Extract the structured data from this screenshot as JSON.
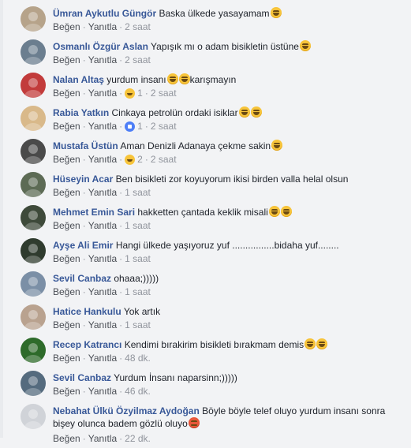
{
  "actions": {
    "like": "Beğen",
    "reply": "Yanıtla",
    "dot": "·"
  },
  "comments": [
    {
      "name": "Ümran Aykutlu Güngör",
      "text": "Baska ülkede yasayamam",
      "emoji": "laugh",
      "emoji_count": 1,
      "reaction": null,
      "time": "2 saat"
    },
    {
      "name": "Osmanlı Özgür Aslan",
      "text": "Yapışık mı o adam bisikletin üstüne",
      "emoji": "laugh",
      "emoji_count": 1,
      "reaction": null,
      "time": "2 saat"
    },
    {
      "name": "Nalan Altaş",
      "text": "yurdum insanı",
      "text_after": "karışmayın",
      "emoji": "laugh",
      "emoji_count": 2,
      "reaction": {
        "type": "haha",
        "count": "1"
      },
      "time": "2 saat"
    },
    {
      "name": "Rabia Yatkın",
      "text": "Cinkaya petrolün ordaki isiklar",
      "emoji": "laugh",
      "emoji_count": 2,
      "reaction": {
        "type": "like",
        "count": "1"
      },
      "time": "2 saat"
    },
    {
      "name": "Mustafa Üstün",
      "text": "Aman Denizli Adanaya çekme sakin",
      "emoji": "laugh",
      "emoji_count": 1,
      "reaction": {
        "type": "haha",
        "count": "2"
      },
      "time": "2 saat"
    },
    {
      "name": "Hüseyin Acar",
      "text": "Ben bisikleti zor koyuyorum ikisi birden valla helal olsun",
      "emoji": null,
      "emoji_count": 0,
      "reaction": null,
      "time": "1 saat"
    },
    {
      "name": "Mehmet Emin Sari",
      "text": "hakketten çantada keklik misali",
      "emoji": "laugh",
      "emoji_count": 2,
      "reaction": null,
      "time": "1 saat"
    },
    {
      "name": "Ayşe Ali Emir",
      "text": "Hangi ülkede yaşıyoruz yuf ................bidaha yuf........",
      "emoji": null,
      "emoji_count": 0,
      "reaction": null,
      "time": "1 saat"
    },
    {
      "name": "Sevil Canbaz",
      "text": "ohaaa;)))))",
      "emoji": null,
      "emoji_count": 0,
      "reaction": null,
      "time": "1 saat"
    },
    {
      "name": "Hatice Hankulu",
      "text": "Yok artık",
      "emoji": null,
      "emoji_count": 0,
      "reaction": null,
      "time": "1 saat"
    },
    {
      "name": "Recep Katrancı",
      "text": "Kendimi bırakirim bisikleti bırakmam demis",
      "emoji": "laugh",
      "emoji_count": 2,
      "reaction": null,
      "time": "48 dk."
    },
    {
      "name": "Sevil Canbaz",
      "text": "Yurdum İnsanı naparsinn;)))))",
      "emoji": null,
      "emoji_count": 0,
      "reaction": null,
      "time": "46 dk."
    },
    {
      "name": "Nebahat Ülkü Özyilmaz Aydoğan",
      "text": "Böyle böyle telef oluyo yurdum insanı sonra bişey olunca badem gözlü oluyo",
      "emoji": "angry",
      "emoji_count": 1,
      "reaction": null,
      "time": "22 dk."
    }
  ],
  "avatar_colors": [
    "#b6a38a",
    "#6b7e8f",
    "#c23b3b",
    "#d9b98a",
    "#4a4a4a",
    "#5d6b55",
    "#3e4a3a",
    "#2f3b2e",
    "#7b8fa6",
    "#b9a28f",
    "#2e6b2a",
    "#556b7e",
    "#d0d3d8"
  ]
}
